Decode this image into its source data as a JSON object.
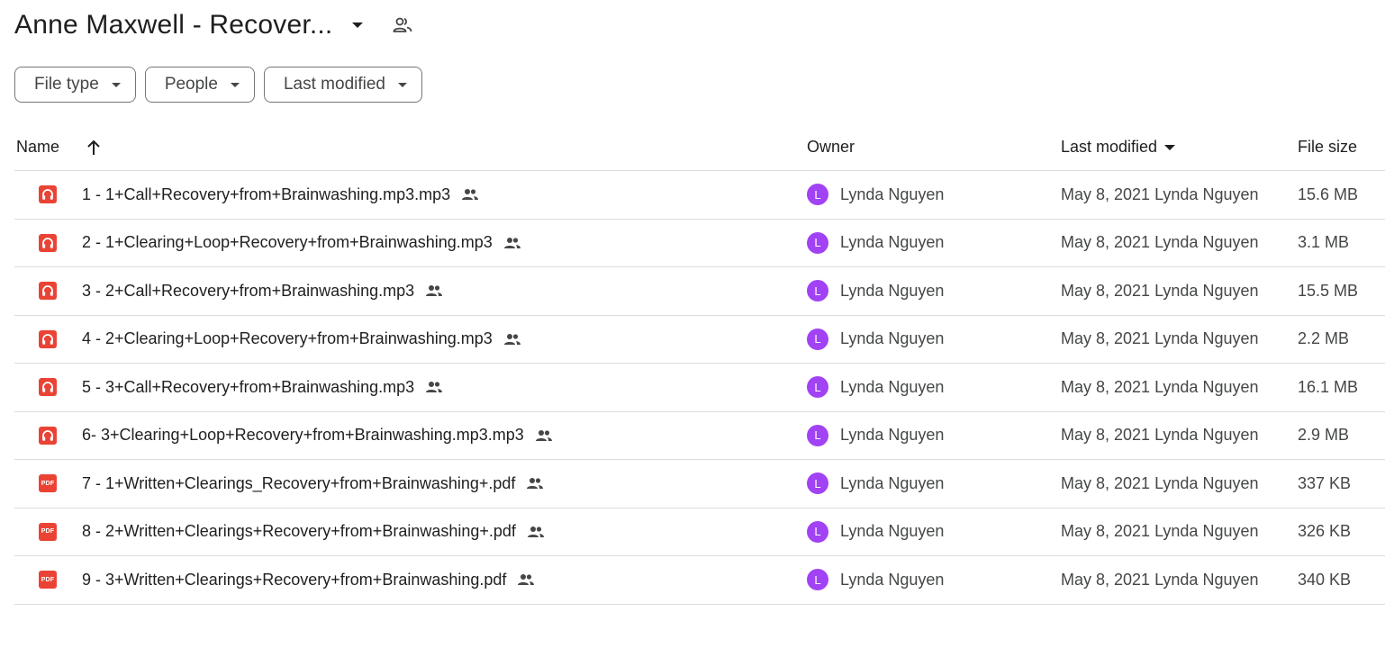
{
  "header": {
    "title": "Anne Maxwell - Recover..."
  },
  "filters": [
    {
      "label": "File type"
    },
    {
      "label": "People"
    },
    {
      "label": "Last modified"
    }
  ],
  "columns": {
    "name": "Name",
    "owner": "Owner",
    "modified": "Last modified",
    "size": "File size"
  },
  "colors": {
    "file_icon": "#ea4335",
    "avatar": "#a142f4",
    "divider": "#dadce0"
  },
  "rows": [
    {
      "icon": "headphones-icon",
      "name": "1 - 1+Call+Recovery+from+Brainwashing.mp3.mp3",
      "owner_initial": "L",
      "owner": "Lynda Nguyen",
      "modified": "May 8, 2021 Lynda Nguyen",
      "size": "15.6 MB"
    },
    {
      "icon": "headphones-icon",
      "name": "2 - 1+Clearing+Loop+Recovery+from+Brainwashing.mp3",
      "owner_initial": "L",
      "owner": "Lynda Nguyen",
      "modified": "May 8, 2021 Lynda Nguyen",
      "size": "3.1 MB"
    },
    {
      "icon": "headphones-icon",
      "name": "3 - 2+Call+Recovery+from+Brainwashing.mp3",
      "owner_initial": "L",
      "owner": "Lynda Nguyen",
      "modified": "May 8, 2021 Lynda Nguyen",
      "size": "15.5 MB"
    },
    {
      "icon": "headphones-icon",
      "name": "4 - 2+Clearing+Loop+Recovery+from+Brainwashing.mp3",
      "owner_initial": "L",
      "owner": "Lynda Nguyen",
      "modified": "May 8, 2021 Lynda Nguyen",
      "size": "2.2 MB"
    },
    {
      "icon": "headphones-icon",
      "name": "5 - 3+Call+Recovery+from+Brainwashing.mp3",
      "owner_initial": "L",
      "owner": "Lynda Nguyen",
      "modified": "May 8, 2021 Lynda Nguyen",
      "size": "16.1 MB"
    },
    {
      "icon": "headphones-icon",
      "name": "6- 3+Clearing+Loop+Recovery+from+Brainwashing.mp3.mp3",
      "owner_initial": "L",
      "owner": "Lynda Nguyen",
      "modified": "May 8, 2021 Lynda Nguyen",
      "size": "2.9 MB"
    },
    {
      "icon": "pdf-icon",
      "icon_text": "PDF",
      "name": "7 - 1+Written+Clearings_Recovery+from+Brainwashing+.pdf",
      "owner_initial": "L",
      "owner": "Lynda Nguyen",
      "modified": "May 8, 2021 Lynda Nguyen",
      "size": "337 KB"
    },
    {
      "icon": "pdf-icon",
      "icon_text": "PDF",
      "name": "8 - 2+Written+Clearings+Recovery+from+Brainwashing+.pdf",
      "owner_initial": "L",
      "owner": "Lynda Nguyen",
      "modified": "May 8, 2021 Lynda Nguyen",
      "size": "326 KB"
    },
    {
      "icon": "pdf-icon",
      "icon_text": "PDF",
      "name": "9 -  3+Written+Clearings+Recovery+from+Brainwashing.pdf",
      "owner_initial": "L",
      "owner": "Lynda Nguyen",
      "modified": "May 8, 2021 Lynda Nguyen",
      "size": "340 KB"
    }
  ]
}
